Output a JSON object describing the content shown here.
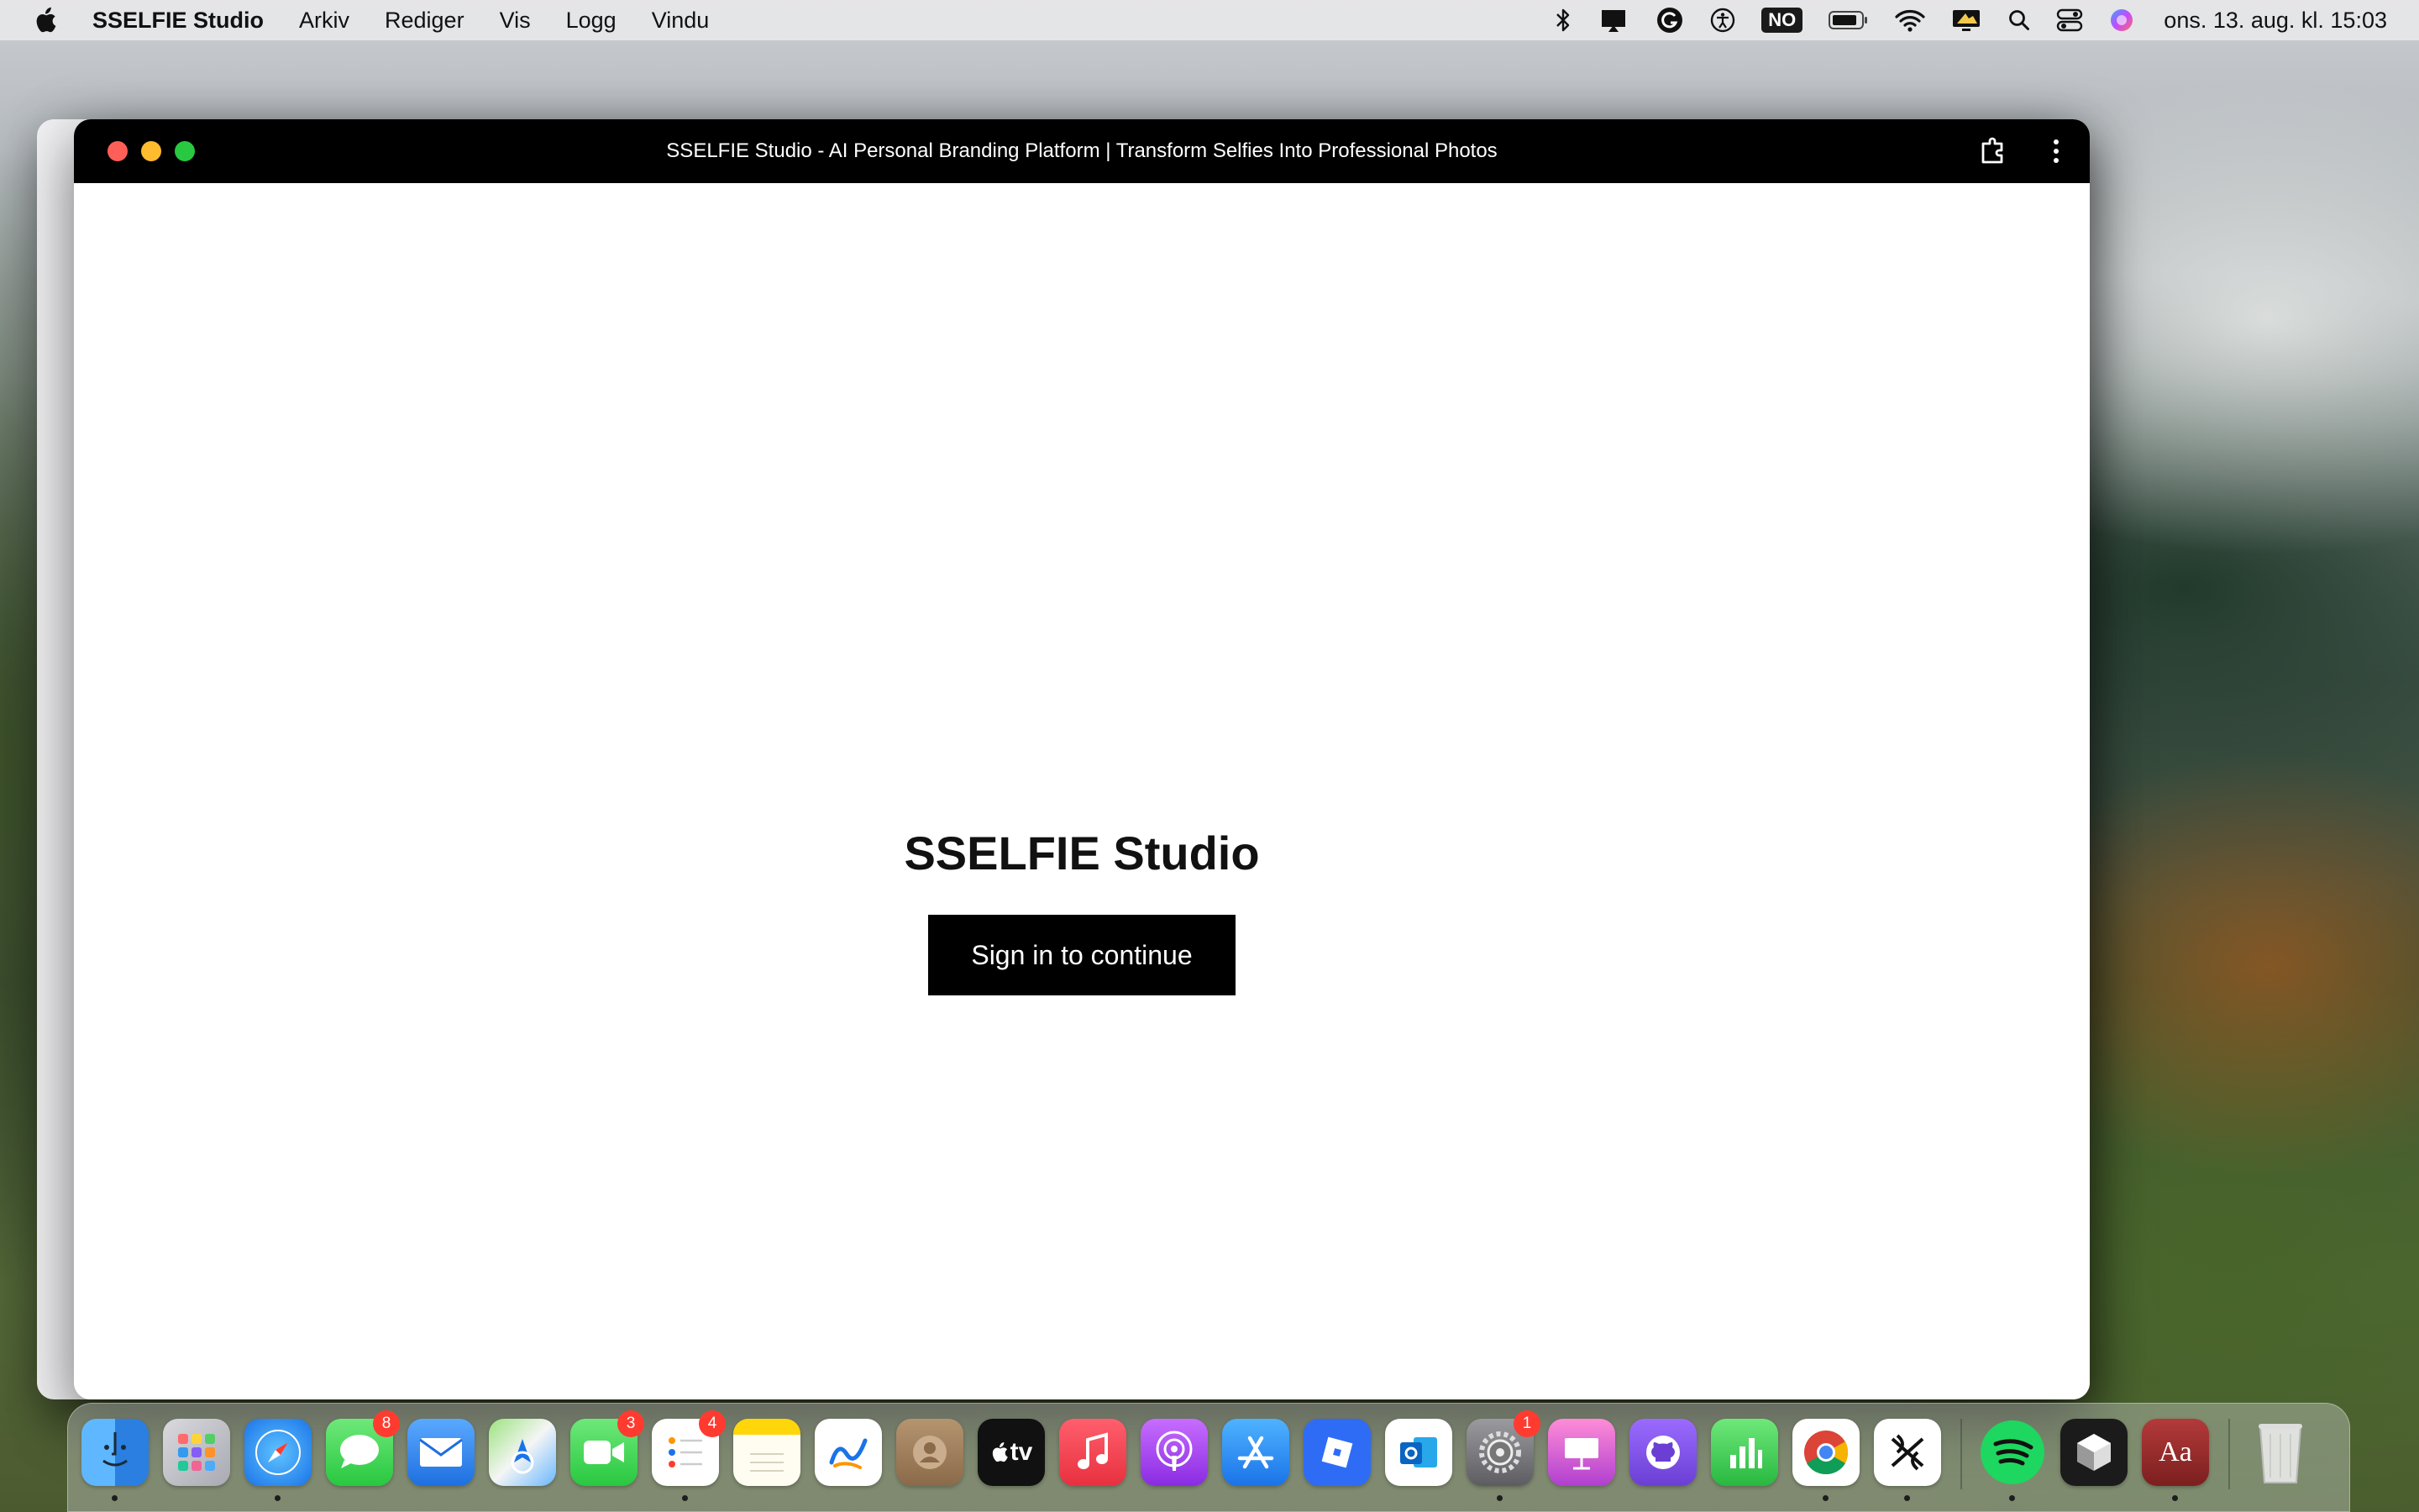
{
  "menubar": {
    "app_name": "SSELFIE Studio",
    "items": [
      "Arkiv",
      "Rediger",
      "Vis",
      "Logg",
      "Vindu"
    ],
    "input_source": "NO",
    "clock": "ons. 13. aug. kl. 15:03"
  },
  "window": {
    "title": "SSELFIE Studio - AI Personal Branding Platform | Transform Selfies Into Professional Photos"
  },
  "page": {
    "heading": "SSELFIE Studio",
    "signin_label": "Sign in to continue"
  },
  "dock": {
    "badges": {
      "messages": "8",
      "facetime": "3",
      "reminders": "4",
      "settings": "1"
    },
    "appletv_label": "tv",
    "dictionary_label": "Aa"
  },
  "colors": {
    "window_titlebar": "#000000",
    "signin_button": "#000000",
    "close": "#ff5f57",
    "minimize": "#febc2e",
    "maximize": "#28c840",
    "badge": "#ff3b30"
  }
}
